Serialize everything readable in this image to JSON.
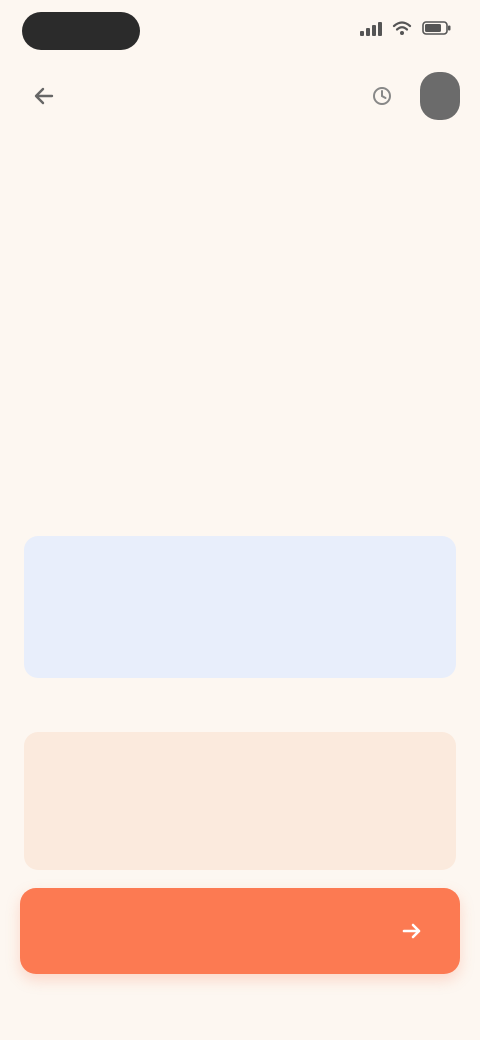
{
  "status_bar": {
    "time": "",
    "battery_level": 0.8
  },
  "header": {
    "title": ""
  },
  "info_card": {
    "title": "",
    "subtitle": "",
    "body": ""
  },
  "section": {
    "label": ""
  },
  "tip_card": {
    "title": "",
    "body": ""
  },
  "cta": {
    "label": ""
  },
  "icons": {
    "back": "arrow-left-icon",
    "action": "history-icon",
    "cta": "arrow-right-icon"
  },
  "colors": {
    "background": "#fdf7f1",
    "accent": "#fc7a52",
    "info_bg": "#e8eefb",
    "info_title": "#4f74c6",
    "tip_bg": "#fbeadd",
    "tip_title": "#e0784d"
  }
}
